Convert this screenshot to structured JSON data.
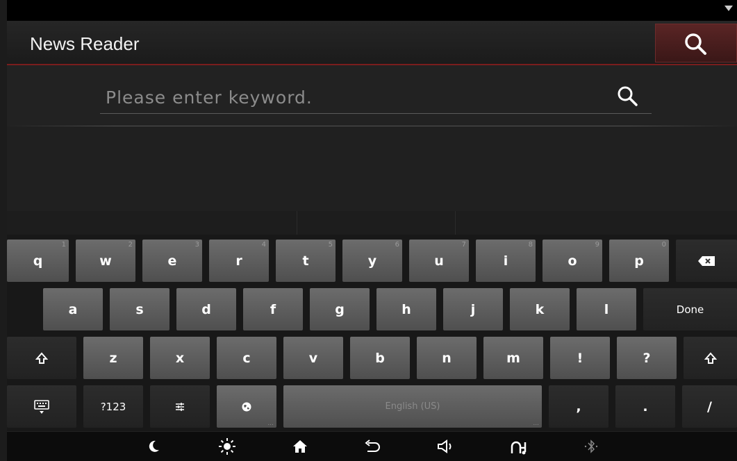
{
  "app": {
    "title": "News Reader"
  },
  "search": {
    "placeholder": "Please enter keyword.",
    "value": ""
  },
  "keyboard": {
    "row1": [
      {
        "label": "q",
        "hint": "1"
      },
      {
        "label": "w",
        "hint": "2"
      },
      {
        "label": "e",
        "hint": "3"
      },
      {
        "label": "r",
        "hint": "4"
      },
      {
        "label": "t",
        "hint": "5"
      },
      {
        "label": "y",
        "hint": "6"
      },
      {
        "label": "u",
        "hint": "7"
      },
      {
        "label": "i",
        "hint": "8"
      },
      {
        "label": "o",
        "hint": "9"
      },
      {
        "label": "p",
        "hint": "0"
      }
    ],
    "row2": [
      "a",
      "s",
      "d",
      "f",
      "g",
      "h",
      "j",
      "k",
      "l"
    ],
    "row3": [
      "z",
      "x",
      "c",
      "v",
      "b",
      "n",
      "m",
      "!",
      "?"
    ],
    "done_label": "Done",
    "numbers_label": "?123",
    "space_label": "English (US)",
    "comma_label": ",",
    "period_label": ".",
    "slash_label": "/",
    "dots": "..."
  },
  "icons": {
    "app_search": "search-icon",
    "field_search": "search-icon",
    "backspace": "backspace-icon",
    "shift": "shift-icon",
    "keyboard": "keyboard-icon",
    "settings": "settings-sliders-icon",
    "language": "globe-icon",
    "nav": [
      "moon-icon",
      "brightness-icon",
      "home-icon",
      "back-icon",
      "volume-icon",
      "media-icon",
      "bluetooth-icon"
    ]
  },
  "colors": {
    "accent": "#a3262b",
    "background": "#222222",
    "key": "#5e5e5e",
    "key_dark": "#262626"
  }
}
